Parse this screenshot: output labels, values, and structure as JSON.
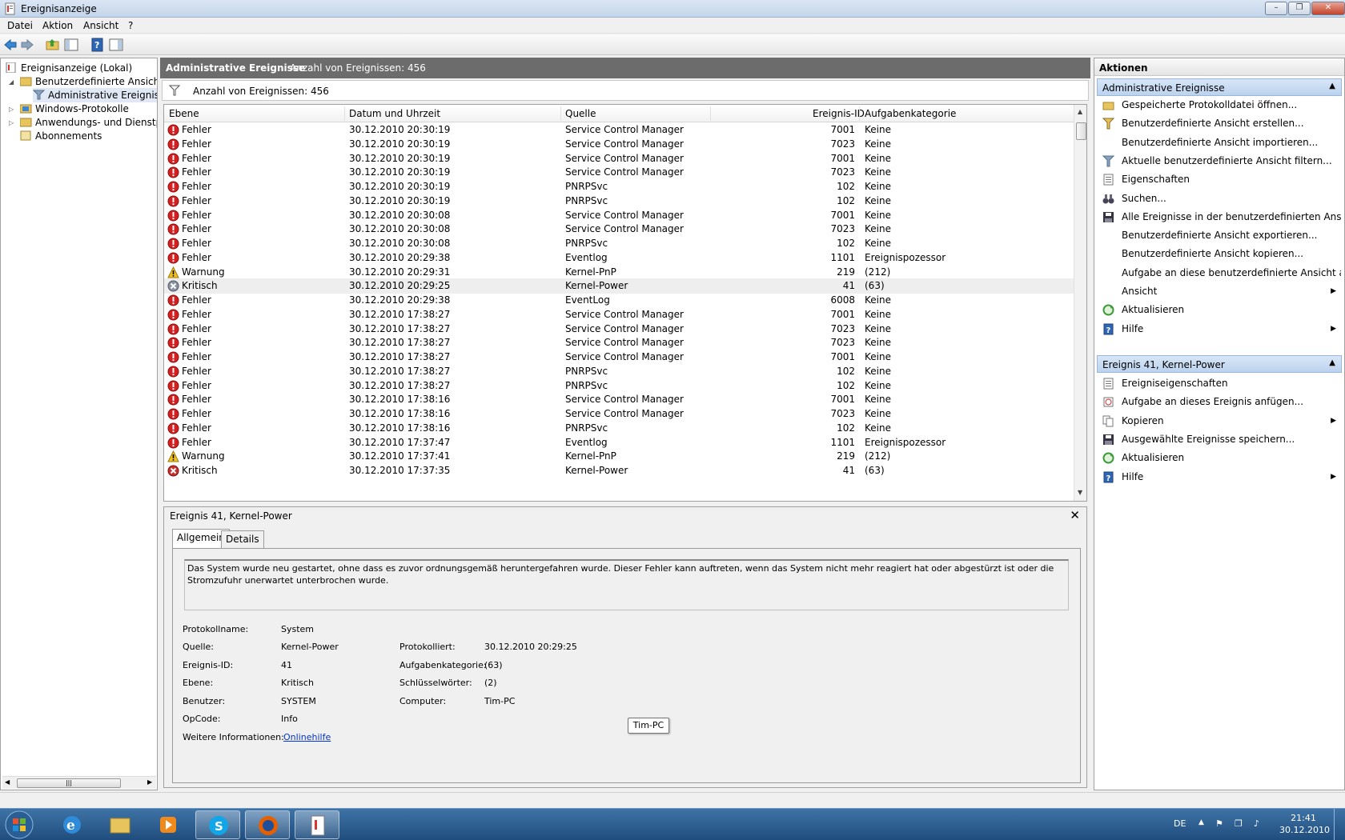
{
  "window": {
    "title": "Ereignisanzeige"
  },
  "menu": [
    "Datei",
    "Aktion",
    "Ansicht",
    "?"
  ],
  "tree": {
    "root": "Ereignisanzeige (Lokal)",
    "custom_views": "Benutzerdefinierte Ansichten",
    "admin_events": "Administrative Ereignisse",
    "windows_logs": "Windows-Protokolle",
    "app_logs": "Anwendungs- und Dienstprotokolle",
    "subscriptions": "Abonnements"
  },
  "center": {
    "title": "Administrative Ereignisse",
    "count_header": "Anzahl von Ereignissen: 456",
    "filter_text": "Anzahl von Ereignissen: 456",
    "columns": [
      "Ebene",
      "Datum und Uhrzeit",
      "Quelle",
      "Ereignis-ID",
      "Aufgabenkategorie"
    ],
    "rows": [
      [
        "error",
        "Fehler",
        "30.12.2010 20:30:19",
        "Service Control Manager",
        "7001",
        "Keine"
      ],
      [
        "error",
        "Fehler",
        "30.12.2010 20:30:19",
        "Service Control Manager",
        "7023",
        "Keine"
      ],
      [
        "error",
        "Fehler",
        "30.12.2010 20:30:19",
        "Service Control Manager",
        "7001",
        "Keine"
      ],
      [
        "error",
        "Fehler",
        "30.12.2010 20:30:19",
        "Service Control Manager",
        "7023",
        "Keine"
      ],
      [
        "error",
        "Fehler",
        "30.12.2010 20:30:19",
        "PNRPSvc",
        "102",
        "Keine"
      ],
      [
        "error",
        "Fehler",
        "30.12.2010 20:30:19",
        "PNRPSvc",
        "102",
        "Keine"
      ],
      [
        "error",
        "Fehler",
        "30.12.2010 20:30:08",
        "Service Control Manager",
        "7001",
        "Keine"
      ],
      [
        "error",
        "Fehler",
        "30.12.2010 20:30:08",
        "Service Control Manager",
        "7023",
        "Keine"
      ],
      [
        "error",
        "Fehler",
        "30.12.2010 20:30:08",
        "PNRPSvc",
        "102",
        "Keine"
      ],
      [
        "error",
        "Fehler",
        "30.12.2010 20:29:38",
        "Eventlog",
        "1101",
        "Ereignispozessor"
      ],
      [
        "warning",
        "Warnung",
        "30.12.2010 20:29:31",
        "Kernel-PnP",
        "219",
        "(212)"
      ],
      [
        "critical",
        "Kritisch",
        "30.12.2010 20:29:25",
        "Kernel-Power",
        "41",
        "(63)"
      ],
      [
        "error",
        "Fehler",
        "30.12.2010 20:29:38",
        "EventLog",
        "6008",
        "Keine"
      ],
      [
        "error",
        "Fehler",
        "30.12.2010 17:38:27",
        "Service Control Manager",
        "7001",
        "Keine"
      ],
      [
        "error",
        "Fehler",
        "30.12.2010 17:38:27",
        "Service Control Manager",
        "7023",
        "Keine"
      ],
      [
        "error",
        "Fehler",
        "30.12.2010 17:38:27",
        "Service Control Manager",
        "7023",
        "Keine"
      ],
      [
        "error",
        "Fehler",
        "30.12.2010 17:38:27",
        "Service Control Manager",
        "7001",
        "Keine"
      ],
      [
        "error",
        "Fehler",
        "30.12.2010 17:38:27",
        "PNRPSvc",
        "102",
        "Keine"
      ],
      [
        "error",
        "Fehler",
        "30.12.2010 17:38:27",
        "PNRPSvc",
        "102",
        "Keine"
      ],
      [
        "error",
        "Fehler",
        "30.12.2010 17:38:16",
        "Service Control Manager",
        "7001",
        "Keine"
      ],
      [
        "error",
        "Fehler",
        "30.12.2010 17:38:16",
        "Service Control Manager",
        "7023",
        "Keine"
      ],
      [
        "error",
        "Fehler",
        "30.12.2010 17:38:16",
        "PNRPSvc",
        "102",
        "Keine"
      ],
      [
        "error",
        "Fehler",
        "30.12.2010 17:37:47",
        "Eventlog",
        "1101",
        "Ereignispozessor"
      ],
      [
        "warning",
        "Warnung",
        "30.12.2010 17:37:41",
        "Kernel-PnP",
        "219",
        "(212)"
      ],
      [
        "critical",
        "Kritisch",
        "30.12.2010 17:37:35",
        "Kernel-Power",
        "41",
        "(63)"
      ]
    ],
    "selected_row": 11
  },
  "detail": {
    "title": "Ereignis 41, Kernel-Power",
    "tabs": [
      "Allgemein",
      "Details"
    ],
    "description": "Das System wurde neu gestartet, ohne dass es zuvor ordnungsgemäß heruntergefahren wurde. Dieser Fehler kann auftreten, wenn das System nicht mehr reagiert hat oder abgestürzt ist oder die Stromzufuhr unerwartet unterbrochen wurde.",
    "fields": {
      "log_name_label": "Protokollname:",
      "log_name": "System",
      "source_label": "Quelle:",
      "source": "Kernel-Power",
      "logged_label": "Protokolliert:",
      "logged": "30.12.2010 20:29:25",
      "event_id_label": "Ereignis-ID:",
      "event_id": "41",
      "task_cat_label": "Aufgabenkategorie:",
      "task_cat": "(63)",
      "level_label": "Ebene:",
      "level": "Kritisch",
      "keywords_label": "Schlüsselwörter:",
      "keywords": "(2)",
      "user_label": "Benutzer:",
      "user": "SYSTEM",
      "computer_label": "Computer:",
      "computer": "Tim-PC",
      "opcode_label": "OpCode:",
      "opcode": "Info",
      "more_info_label": "Weitere Informationen:",
      "more_info_link": "Onlinehilfe"
    },
    "tooltip": "Tim-PC"
  },
  "actions": {
    "header": "Aktionen",
    "section1": "Administrative Ereignisse",
    "items1": [
      {
        "label": "Gespeicherte Protokolldatei öffnen...",
        "icon": "folder-open-icon"
      },
      {
        "label": "Benutzerdefinierte Ansicht erstellen...",
        "icon": "filter-create-icon"
      },
      {
        "label": "Benutzerdefinierte Ansicht importieren...",
        "icon": ""
      },
      {
        "label": "Aktuelle benutzerdefinierte Ansicht filtern...",
        "icon": "filter-icon"
      },
      {
        "label": "Eigenschaften",
        "icon": "properties-icon"
      },
      {
        "label": "Suchen...",
        "icon": "binoculars-icon"
      },
      {
        "label": "Alle Ereignisse in der benutzerdefinierten Ansi...",
        "icon": "save-icon"
      },
      {
        "label": "Benutzerdefinierte Ansicht exportieren...",
        "icon": ""
      },
      {
        "label": "Benutzerdefinierte Ansicht kopieren...",
        "icon": ""
      },
      {
        "label": "Aufgabe an diese benutzerdefinierte Ansicht a...",
        "icon": ""
      },
      {
        "label": "Ansicht",
        "icon": "",
        "submenu": true
      },
      {
        "label": "Aktualisieren",
        "icon": "refresh-icon"
      },
      {
        "label": "Hilfe",
        "icon": "help-icon",
        "submenu": true
      }
    ],
    "section2": "Ereignis 41, Kernel-Power",
    "items2": [
      {
        "label": "Ereigniseigenschaften",
        "icon": "properties-icon"
      },
      {
        "label": "Aufgabe an dieses Ereignis anfügen...",
        "icon": "task-icon"
      },
      {
        "label": "Kopieren",
        "icon": "copy-icon",
        "submenu": true
      },
      {
        "label": "Ausgewählte Ereignisse speichern...",
        "icon": "save-icon"
      },
      {
        "label": "Aktualisieren",
        "icon": "refresh-icon"
      },
      {
        "label": "Hilfe",
        "icon": "help-icon",
        "submenu": true
      }
    ]
  },
  "taskbar": {
    "lang": "DE",
    "time": "21:41",
    "date": "30.12.2010"
  }
}
